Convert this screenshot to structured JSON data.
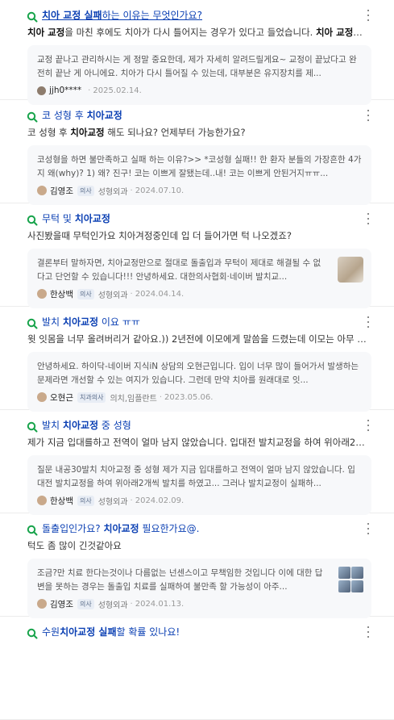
{
  "results": [
    {
      "title_parts": [
        [
          "치아 교정 실패",
          true
        ],
        [
          "하는 이유는 무엇인가요?",
          false
        ]
      ],
      "question_parts": [
        [
          "치아 교정",
          true
        ],
        [
          "을 마친 후에도 치아가 다시 틀어지는 경우가 있다고 들었습니다. ",
          false
        ],
        [
          "치아 교정",
          true
        ],
        [
          "이 ...",
          false
        ]
      ],
      "answer": "교정 끝나고 관리하시는 게 정말 중요한데, 제가 자세히 알려드릴게요~ 교정이 끝났다고 완전히 끝난 게 아니에요. 치아가 다시 틀어질 수 있는데, 대부분은 유지장치를 제...",
      "author": "jjh0****",
      "badge": "",
      "dept": "",
      "date": "2025.02.14."
    },
    {
      "title_parts": [
        [
          "코 성형 후 ",
          false
        ],
        [
          "치아교정",
          true
        ]
      ],
      "question_parts": [
        [
          "코 성형 후 ",
          false
        ],
        [
          "치아교정",
          true
        ],
        [
          " 해도 되나요? 언제부터 가능한가요?",
          false
        ]
      ],
      "answer": "코성형을 하면 불만족하고 실패 하는 이유?>> *코성형 실패!! 한 환자 분들의 가장흔한 4가지 왜(why)? 1) 왜? 진구! 코는 이쁘게 잘됐는데..내! 코는 이쁘게 안된거지ㅠㅠ...",
      "author": "김영조",
      "badge": "의사",
      "dept": "성형외과",
      "date": "2024.07.10."
    },
    {
      "title_parts": [
        [
          "무턱 및 ",
          false
        ],
        [
          "치아교정",
          true
        ]
      ],
      "question_parts": [
        [
          "사진봤을때 무턱인가요 치아겨정중인데 입 더 들어가면 턱 나오겠죠?",
          false
        ]
      ],
      "answer": "결론부터 말하자면, 치아교정만으로 절대로 돌출입과 무턱이 제대로 해결될 수 없다고 단언할 수 있습니다!!! 안녕하세요. 대한의사협회·네이버 발치교...",
      "author": "한상백",
      "badge": "의사",
      "dept": "성형외과",
      "date": "2024.04.14."
    },
    {
      "title_parts": [
        [
          "발치 ",
          false
        ],
        [
          "치아교정",
          true
        ],
        [
          " 이요 ㅠㅠ",
          false
        ]
      ],
      "question_parts": [
        [
          "윗 잇몸을 너무 올려버리거 같아요.)) 2년전에 이모에게 말씀을 드렸는데 이모는 아무 문...",
          false
        ]
      ],
      "answer": "안녕하세요. 하이닥-네이버 지식iN 상담의 오현근입니다. 입이 너무 많이 들어가서 발생하는 문제라면 개선할 수 있는 여지가 있습니다. 그런데 만약 치아를 원래대로 잇...",
      "author": "오현근",
      "badge": "치과의사",
      "dept": "의치,임플란트",
      "date": "2023.05.06."
    },
    {
      "title_parts": [
        [
          "발치 ",
          false
        ],
        [
          "치아교정",
          true
        ],
        [
          " 중 성형",
          false
        ]
      ],
      "question_parts": [
        [
          "제가 지금 입대를하고 전역이 얼마 남지 않았습니다. 입대전 발치교정을 하여 위아래2개...",
          false
        ]
      ],
      "answer": "질문 내공30발치 치아교정 중 성형 제가 지금 입대를하고 전역이 얼마 남지 않았습니다. 입대전 발치교정을 하여 위아래2개씩 발치를 하였고... 그러나 발치교정이 실패하...",
      "author": "한상백",
      "badge": "의사",
      "dept": "성형외과",
      "date": "2024.02.09."
    },
    {
      "title_parts": [
        [
          "돌출입인가요? ",
          false
        ],
        [
          "치아교정",
          true
        ],
        [
          " 필요한가요@.",
          false
        ]
      ],
      "question_parts": [
        [
          "턱도 좀 많이 긴것같아요",
          false
        ]
      ],
      "answer": "조금?만 치료 한다는것이나 다름없는 넌센스이고 무책임한 것입니다 이에 대한 답변을 못하는 경우는 돌출입 치료를 실패하여 불만족 할 가능성이 아주...",
      "author": "김영조",
      "badge": "의사",
      "dept": "성형외과",
      "date": "2024.01.13."
    },
    {
      "title_parts": [
        [
          "수원",
          false
        ],
        [
          "치아교정 실패",
          true
        ],
        [
          "할 확률 있나요!",
          false
        ]
      ],
      "question_parts": [],
      "answer": "",
      "author": "",
      "badge": "",
      "dept": "",
      "date": ""
    }
  ],
  "icons": {
    "qna": "q-search-icon",
    "more": "more-vertical-icon",
    "avatar": "avatar"
  },
  "colors": {
    "title": "#0a3fb3",
    "qicon": "#16a34a",
    "card_bg": "#f7f8fa"
  }
}
